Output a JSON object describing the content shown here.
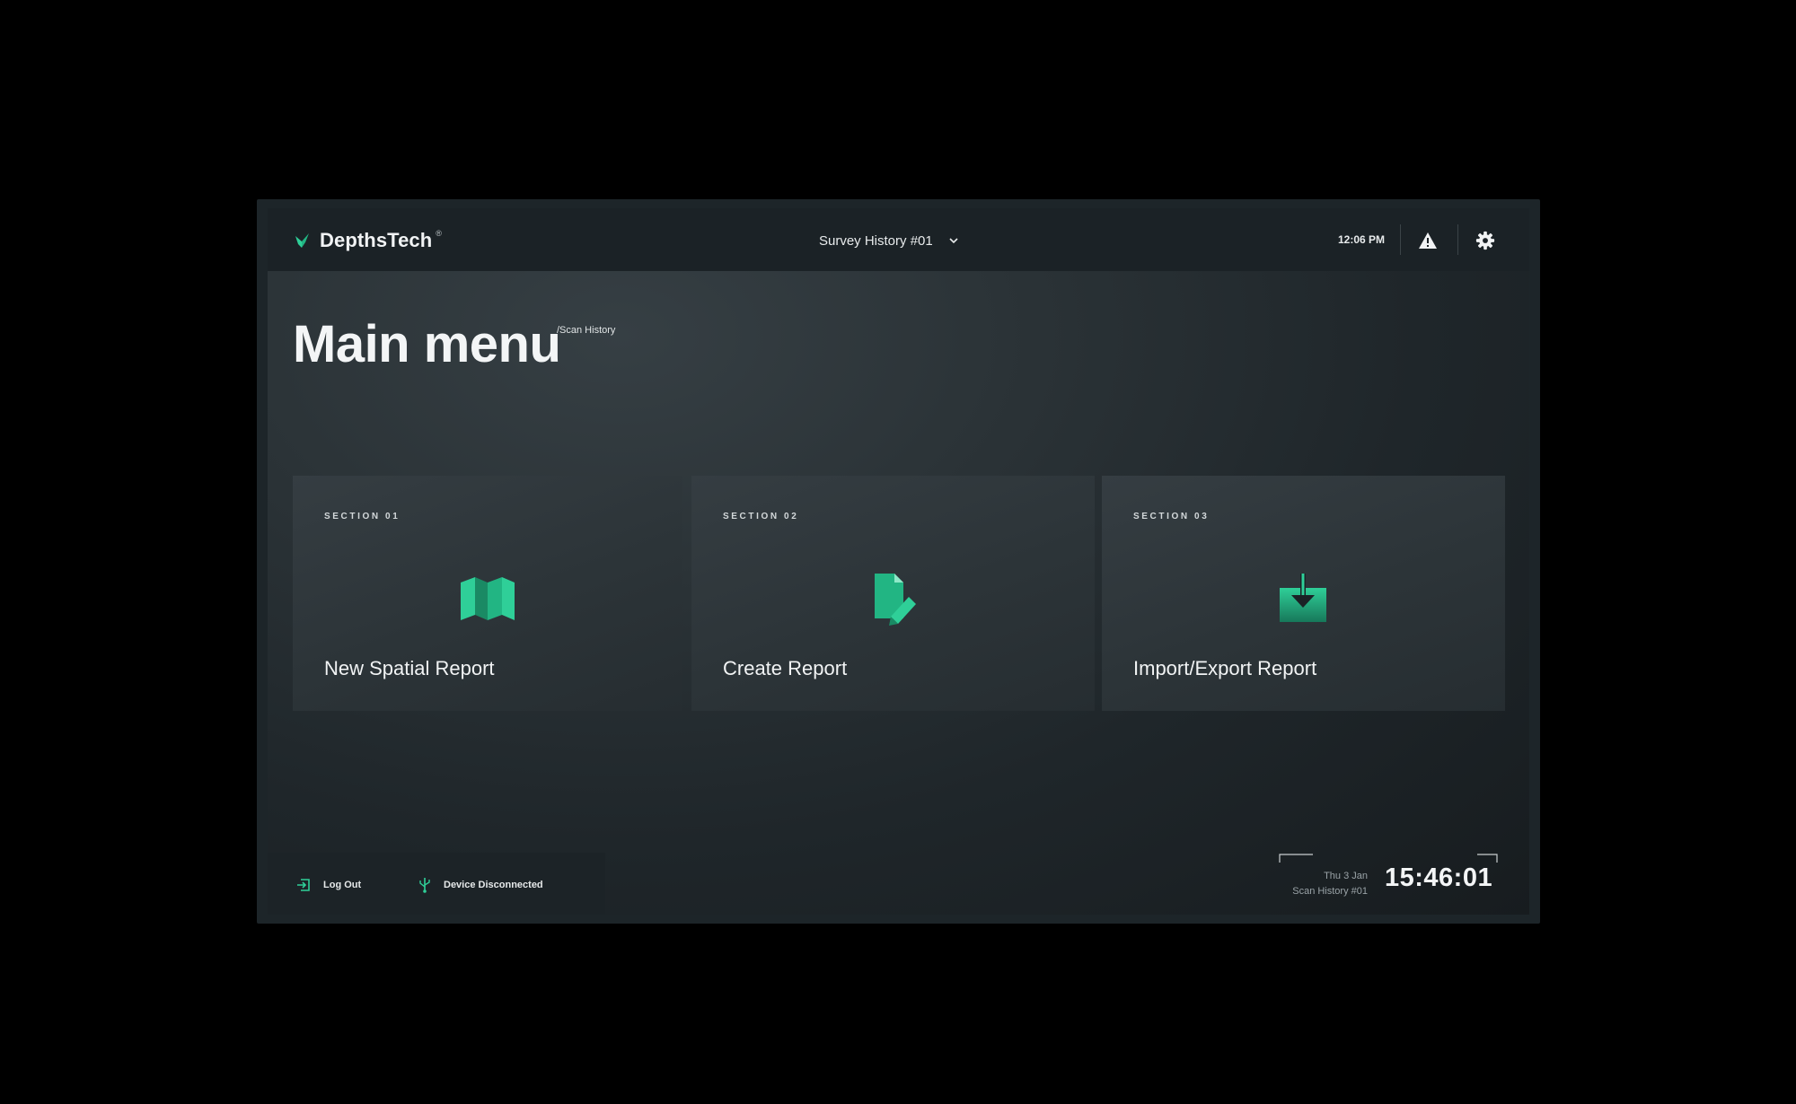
{
  "topbar": {
    "brand_name": "DepthsTech",
    "brand_mark": "®",
    "survey_selector": "Survey History #01",
    "time": "12:06 PM",
    "icons": [
      "leaf-logo-icon",
      "chevron-down-icon",
      "warning-icon",
      "gear-icon"
    ]
  },
  "header": {
    "title": "Main menu",
    "breadcrumb": "/Scan History"
  },
  "cards": [
    {
      "section": "SECTION 01",
      "label": "New Spatial Report",
      "icon": "map-icon"
    },
    {
      "section": "SECTION 02",
      "label": "Create Report",
      "icon": "document-edit-icon"
    },
    {
      "section": "SECTION 03",
      "label": "Import/Export Report",
      "icon": "download-tray-icon"
    }
  ],
  "footer": {
    "logout_label": "Log Out",
    "device_status": "Device Disconnected",
    "date": "Thu 3 Jan",
    "scan_name": "Scan History #01",
    "clock": "15:46:01"
  },
  "colors": {
    "accent": "#2fcf98",
    "accent_dark": "#1a8a64",
    "background": "#000000",
    "panel": "#1b2226"
  }
}
